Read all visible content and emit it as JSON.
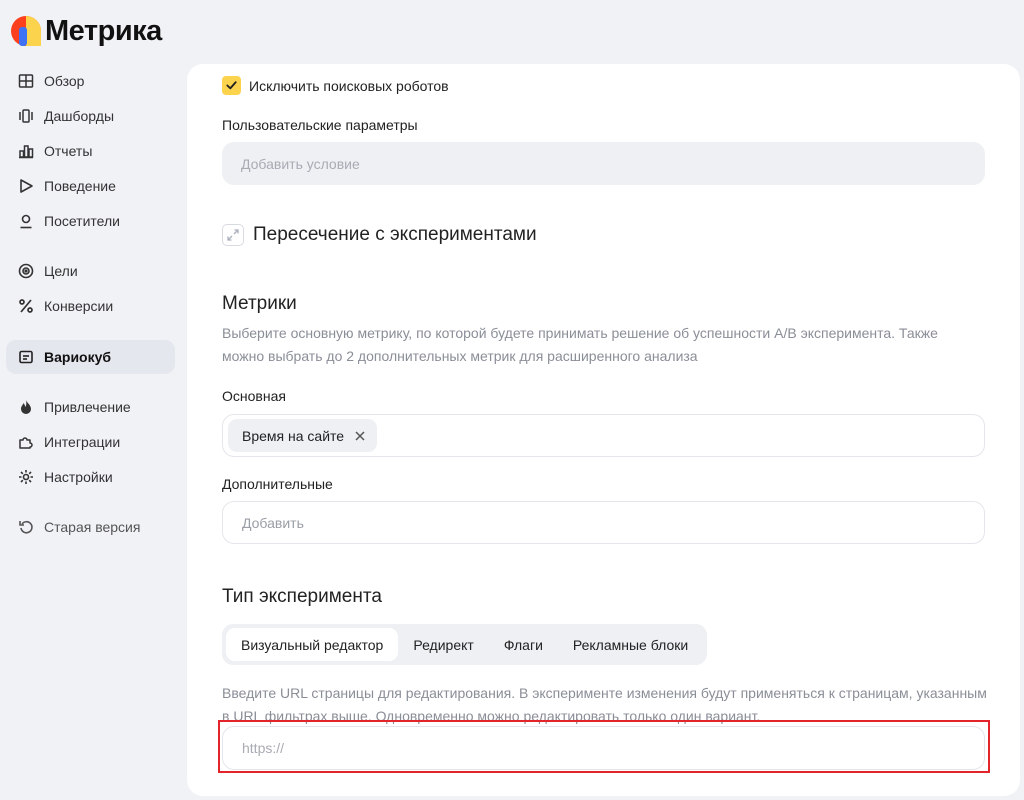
{
  "app": {
    "logo_text": "Метрика"
  },
  "sidebar": {
    "items": [
      {
        "label": "Обзор",
        "icon": "grid-icon"
      },
      {
        "label": "Дашборды",
        "icon": "dashboards-icon"
      },
      {
        "label": "Отчеты",
        "icon": "bar-chart-icon"
      },
      {
        "label": "Поведение",
        "icon": "play-icon"
      },
      {
        "label": "Посетители",
        "icon": "user-icon"
      },
      {
        "label": "Цели",
        "icon": "target-icon"
      },
      {
        "label": "Конверсии",
        "icon": "percent-icon"
      },
      {
        "label": "Вариокуб",
        "icon": "variocube-icon",
        "active": true
      },
      {
        "label": "Привлечение",
        "icon": "flame-icon"
      },
      {
        "label": "Интеграции",
        "icon": "puzzle-icon"
      },
      {
        "label": "Настройки",
        "icon": "gear-icon"
      },
      {
        "label": "Старая версия",
        "icon": "undo-icon"
      }
    ]
  },
  "form": {
    "exclude_robots": {
      "label": "Исключить поисковых роботов",
      "checked": true
    },
    "user_params": {
      "label": "Пользовательские параметры",
      "placeholder": "Добавить условие"
    },
    "intersection_link": "Пересечение с экспериментами",
    "metrics": {
      "title": "Метрики",
      "description": "Выберите основную метрику, по которой будете принимать решение об успешности A/B эксперимента. Также можно выбрать до 2 дополнительных метрик для расширенного анализа",
      "primary_label": "Основная",
      "primary_chip": "Время на сайте",
      "secondary_label": "Дополнительные",
      "secondary_placeholder": "Добавить"
    },
    "experiment_type": {
      "title": "Тип эксперимента",
      "tabs": [
        "Визуальный редактор",
        "Редирект",
        "Флаги",
        "Рекламные блоки"
      ],
      "active_tab": 0,
      "hint": "Введите URL страницы для редактирования. В эксперименте изменения будут применяться к страницам, указанным в URL фильтрах выше. Одновременно можно редактировать только один вариант.",
      "url_placeholder": "https://"
    }
  },
  "colors": {
    "accent_yellow": "#fcd34d",
    "highlight_red": "#e3242b"
  }
}
